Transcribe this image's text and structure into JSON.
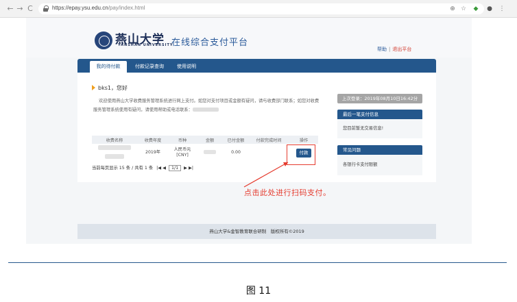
{
  "browser": {
    "url_host": "https://epay.ysu.edu.cn",
    "url_path": "/pay/index.html",
    "back": "←",
    "forward": "→",
    "reload": "C",
    "zoom_icon": "⊕",
    "star_icon": "☆",
    "more_icon": "⋮"
  },
  "header": {
    "logo_cn": "燕山大学",
    "logo_en": "YANSHAN UNIVERSITY",
    "platform_title": "在线综合支付平台",
    "help": "帮助",
    "separator": "|",
    "logout": "退出平台"
  },
  "tabs": [
    {
      "label": "我的待付款"
    },
    {
      "label": "付款记录查询"
    },
    {
      "label": "使用说明"
    }
  ],
  "main": {
    "greeting": "bks1，您好",
    "welcome_1": "欢迎使用燕山大学收费服务管理系统进行网上支付。如您对支付项目或金额有疑问，请与收费部门联系；如您对收费服务管理系统使用有疑问，请使用帮助或电话联系："
  },
  "table": {
    "headers": [
      "收费名称",
      "收费年度",
      "币种",
      "金额",
      "已付金额",
      "付款完成时间",
      "操作"
    ],
    "row": {
      "year": "2019年",
      "currency_1": "人民币元",
      "currency_2": "[CNY]",
      "paid": "0.00",
      "pay_button": "付款"
    },
    "pager_text": "当前每页显示 15 条 / 共有 1 条",
    "pager_first": "|◀",
    "pager_prev": "◀",
    "pager_page": "1/1",
    "pager_next": "▶",
    "pager_last": "▶|"
  },
  "sidebar": {
    "last_login": "上次登录：2019年08月10日16:42分",
    "latest_title": "最后一笔支付信息",
    "latest_body": "您目前暂无交易信息!",
    "faq_title": "常见问题",
    "faq_item": "各银行卡支付限额"
  },
  "annotation": "点击此处进行扫码支付。",
  "footer": "燕山大学&金智教育联合研制　版权所有©2019",
  "caption": "图 11",
  "colors": {
    "primary": "#24578c",
    "highlight": "#e53b2e",
    "logout": "#d23b2e"
  }
}
